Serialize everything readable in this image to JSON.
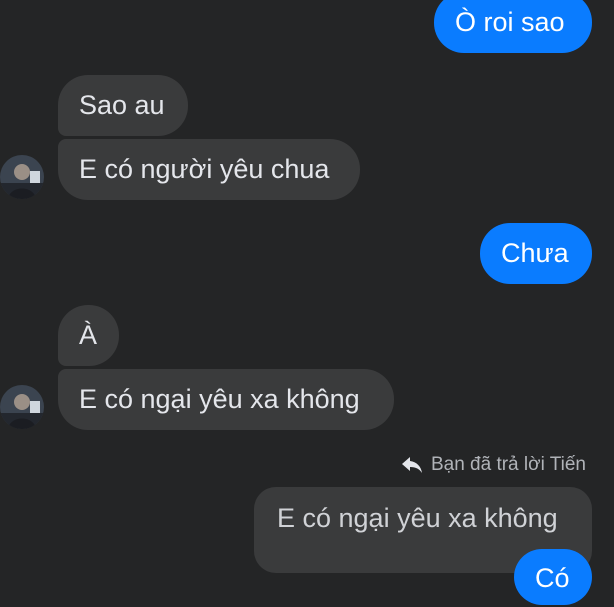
{
  "messages": {
    "outgoing_top": "Ò roi sao",
    "incoming_1": "Sao au",
    "incoming_2": "E có người yêu chua",
    "outgoing_2": "Chưa",
    "incoming_3": "À",
    "incoming_4": "E có ngại yêu xa không",
    "reply_label": "Bạn đã trả lời Tiến",
    "quoted_text": "E có ngại yêu xa không",
    "outgoing_reply": "Có"
  },
  "colors": {
    "background": "#242526",
    "incoming_bubble": "#3a3b3c",
    "outgoing_bubble": "#0a7cff"
  },
  "icons": {
    "reply": "reply-arrow-icon",
    "avatar": "profile-avatar"
  }
}
